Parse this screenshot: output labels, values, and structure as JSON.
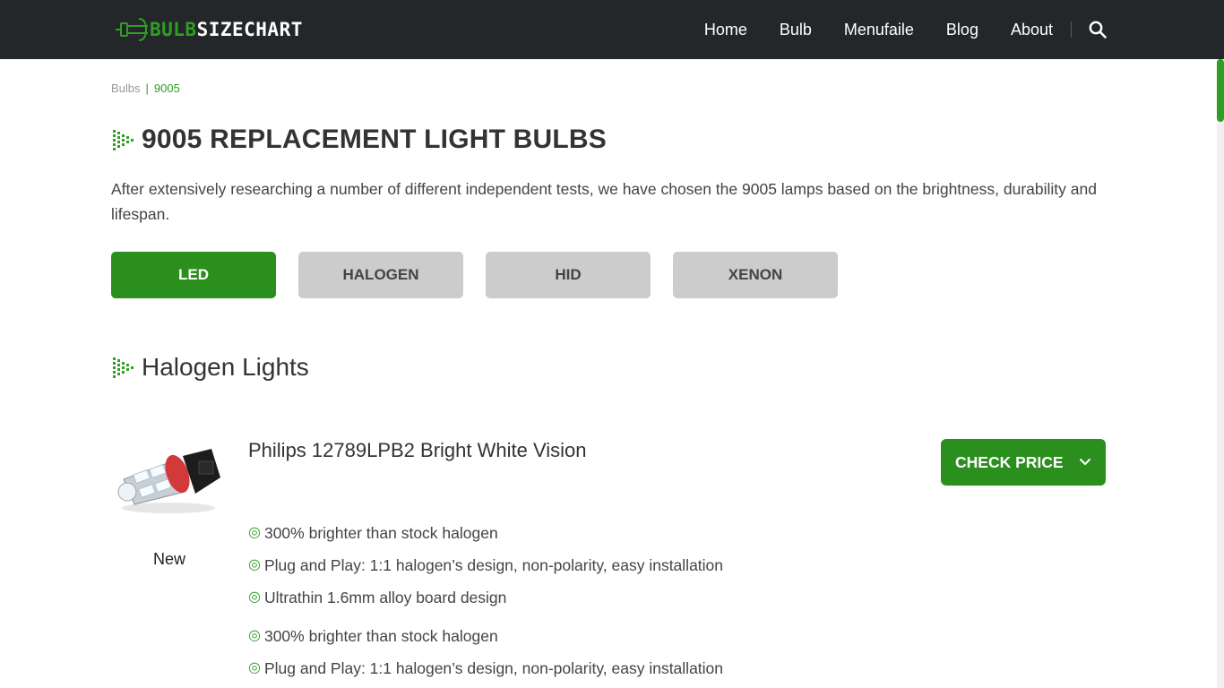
{
  "header": {
    "logo_part1": "BULB",
    "logo_part2": "SIZECHART",
    "nav": [
      "Home",
      "Bulb",
      "Menufaile",
      "Blog",
      "About"
    ]
  },
  "breadcrumb": {
    "parent": "Bulbs",
    "separator": "|",
    "current": "9005"
  },
  "page": {
    "title": "9005 REPLACEMENT LIGHT BULBS",
    "intro": "After extensively researching a number of different independent tests, we have chosen the 9005 lamps based on the brightness, durability and lifespan."
  },
  "tabs": [
    {
      "label": "LED",
      "active": true
    },
    {
      "label": "HALOGEN",
      "active": false
    },
    {
      "label": "HID",
      "active": false
    },
    {
      "label": "XENON",
      "active": false
    }
  ],
  "section": {
    "title": "Halogen Lights"
  },
  "product": {
    "name": "Philips 12789LPB2 Bright White Vision",
    "badge": "New",
    "cta": "CHECK PRICE",
    "features": [
      "300% brighter than stock halogen",
      "Plug and Play: 1:1 halogen’s design, non-polarity, easy installation",
      "Ultrathin 1.6mm alloy board design",
      "300% brighter than stock halogen",
      "Plug and Play: 1:1 halogen’s design, non-polarity, easy installation"
    ]
  },
  "colors": {
    "accent": "#2b8f1e",
    "header_bg": "#23272a",
    "tab_inactive": "#cccccc"
  },
  "icons": [
    "bulb-logo-icon",
    "search-icon",
    "arrow-dots-icon",
    "chevron-down-icon",
    "bullet-circle-icon"
  ]
}
